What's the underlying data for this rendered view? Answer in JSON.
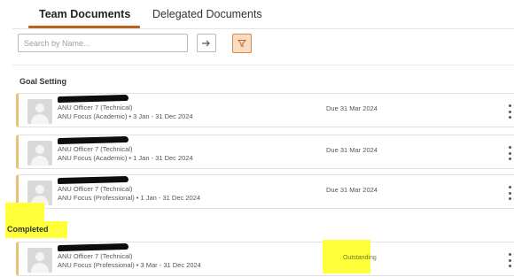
{
  "tabs": [
    {
      "label": "Team Documents",
      "active": true
    },
    {
      "label": "Delegated Documents",
      "active": false
    }
  ],
  "search": {
    "placeholder": "Search by Name...",
    "value": ""
  },
  "icons": {
    "go": "arrow-right-icon",
    "filter": "filter-icon",
    "more": "kebab-menu-icon",
    "avatar": "person-placeholder-icon"
  },
  "colors": {
    "accent": "#b5651d",
    "filter_bg": "#f8ddc4",
    "card_accent": "#e8c07a",
    "highlight": "#ffff3a"
  },
  "sections": [
    {
      "title": "Goal Setting",
      "items": [
        {
          "name": "",
          "role": "ANU Officer 7 (Technical)",
          "plan": "ANU Focus (Academic) • 3 Jan - 31 Dec 2024",
          "status": "Due 31 Mar 2024"
        },
        {
          "name": "",
          "role": "ANU Officer 7 (Technical)",
          "plan": "ANU Focus (Academic) • 1 Jan - 31 Dec 2024",
          "status": "Due 31 Mar 2024"
        },
        {
          "name": "",
          "role": "ANU Officer 7 (Technical)",
          "plan": "ANU Focus (Professional) • 1 Jan - 31 Dec 2024",
          "status": "Due 31 Mar 2024"
        }
      ]
    },
    {
      "title": "Completed",
      "items": [
        {
          "name": "",
          "role": "ANU Officer 7 (Technical)",
          "plan": "ANU Focus (Professional) • 3 Mar - 31 Dec 2024",
          "status": "Outstanding"
        }
      ]
    }
  ]
}
